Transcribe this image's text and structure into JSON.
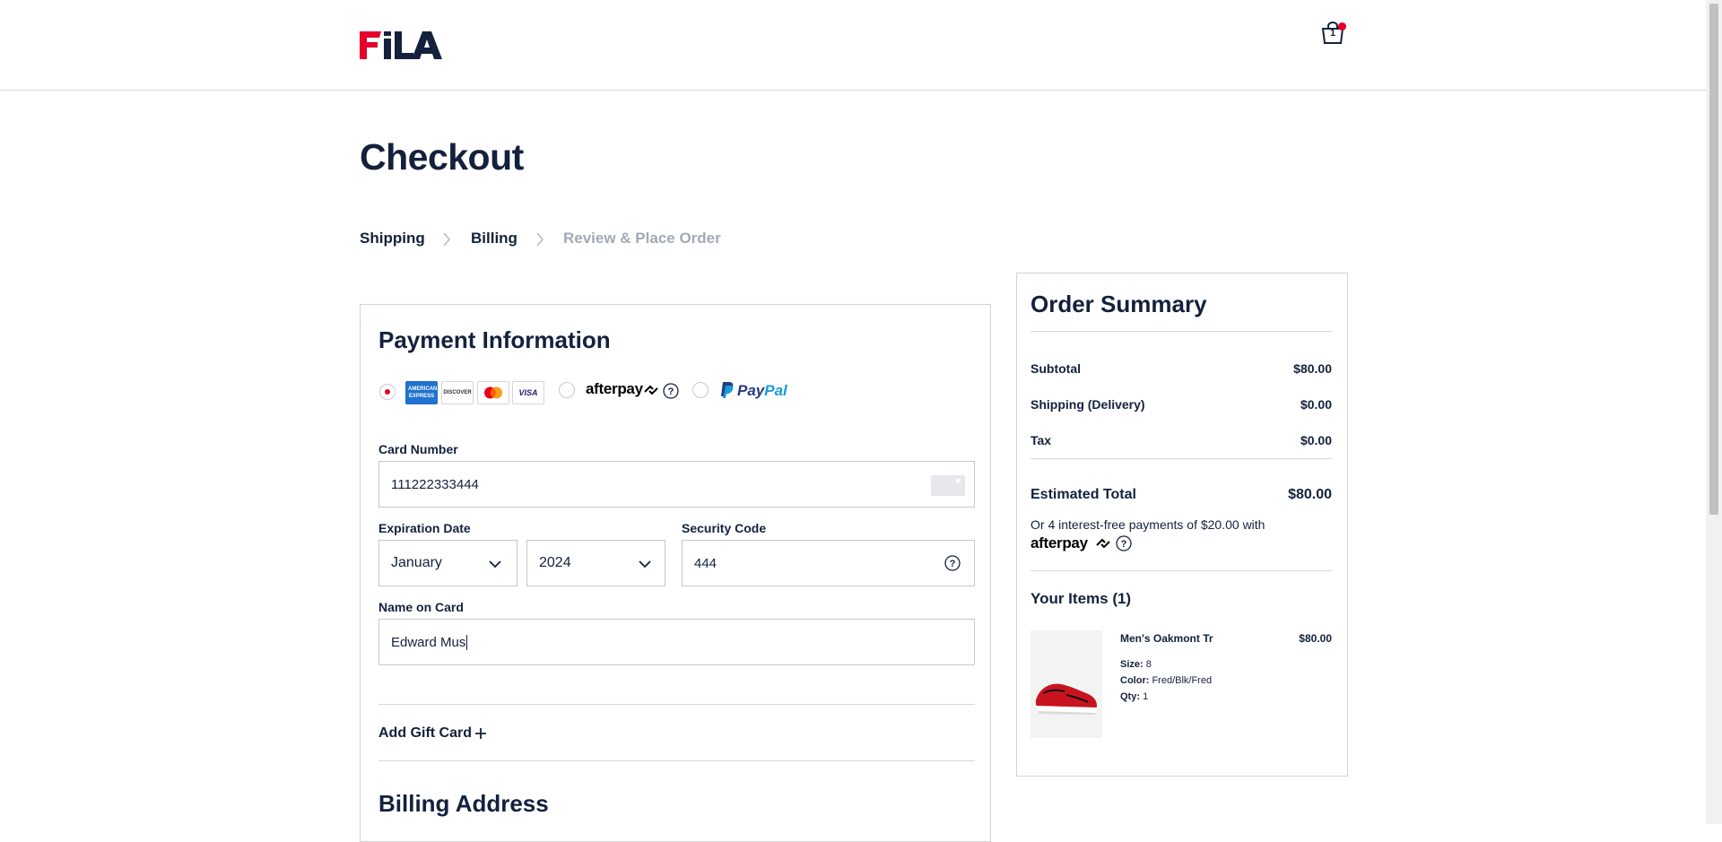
{
  "header": {
    "brand": "FILA",
    "cart_count": "1"
  },
  "page": {
    "title": "Checkout"
  },
  "breadcrumb": {
    "steps": [
      {
        "label": "Shipping",
        "state": "complete"
      },
      {
        "label": "Billing",
        "state": "current"
      },
      {
        "label": "Review & Place Order",
        "state": "upcoming"
      }
    ]
  },
  "payment": {
    "title": "Payment Information",
    "methods": {
      "cards_selected": true,
      "cards": [
        "AMERICAN EXPRESS",
        "DISCOVER",
        "mastercard",
        "VISA"
      ],
      "afterpay_label": "afterpay",
      "paypal_label": "PayPal"
    },
    "card_number": {
      "label": "Card Number",
      "value": "111222333444"
    },
    "expiration": {
      "label": "Expiration Date",
      "month": "January",
      "year": "2024"
    },
    "security_code": {
      "label": "Security Code",
      "value": "444"
    },
    "name_on_card": {
      "label": "Name on Card",
      "value": "Edward Mus"
    },
    "gift_card": {
      "label": "Add Gift Card"
    },
    "billing_title": "Billing Address"
  },
  "summary": {
    "title": "Order Summary",
    "rows": [
      {
        "label": "Subtotal",
        "value": "$80.00"
      },
      {
        "label": "Shipping (Delivery)",
        "value": "$0.00"
      },
      {
        "label": "Tax",
        "value": "$0.00"
      }
    ],
    "estimated_total": {
      "label": "Estimated Total",
      "value": "$80.00"
    },
    "installments_text": "Or 4 interest-free payments of $20.00 with",
    "afterpay_label": "afterpay",
    "items_title": "Your Items (1)",
    "items": [
      {
        "name": "Men's Oakmont Tr",
        "price": "$80.00",
        "size_label": "Size:",
        "size": "8",
        "color_label": "Color:",
        "color": "Fred/Blk/Fred",
        "qty_label": "Qty:",
        "qty": "1"
      }
    ]
  },
  "colors": {
    "navy": "#14213d",
    "brand_red": "#e4002b",
    "muted": "#a3a9b5",
    "paypal_dark": "#253b80",
    "paypal_light": "#179bd7"
  }
}
